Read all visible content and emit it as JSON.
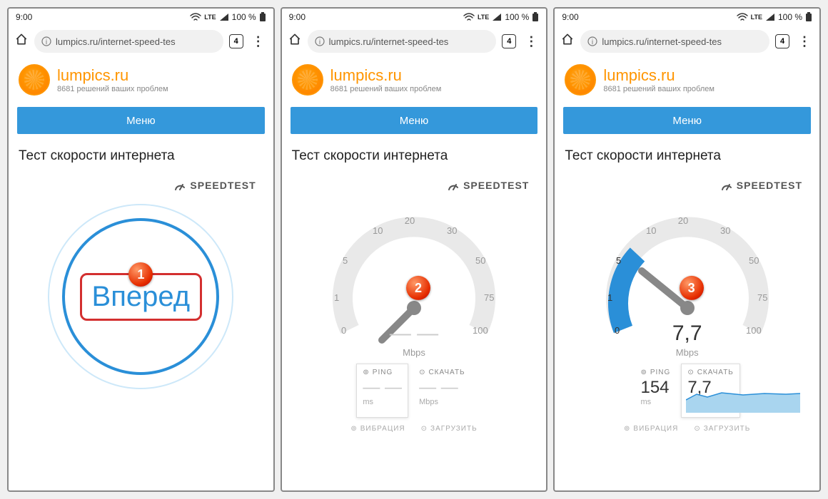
{
  "status": {
    "time": "9:00",
    "net": "LTE",
    "battery": "100 %"
  },
  "browser": {
    "url": "lumpics.ru/internet-speed-tes",
    "tabs": "4"
  },
  "site": {
    "title": "lumpics.ru",
    "subtitle": "8681 решений ваших проблем",
    "menu": "Меню"
  },
  "page": {
    "title": "Тест скорости интернета"
  },
  "speedtest": {
    "brand": "SPEEDTEST"
  },
  "go_button": "Вперед",
  "steps": {
    "s1": "1",
    "s2": "2",
    "s3": "3"
  },
  "gauge": {
    "ticks": [
      "0",
      "1",
      "5",
      "10",
      "20",
      "30",
      "50",
      "75",
      "100"
    ],
    "unit": "Mbps",
    "value_empty": "— —",
    "value3": "7,7"
  },
  "metrics": {
    "ping_label": "PING",
    "ping_unit": "ms",
    "ping_empty": "— —",
    "ping_value3": "154",
    "download_label": "СКАЧАТЬ",
    "download_unit": "Mbps",
    "download_empty": "— —",
    "download_value3": "7,7",
    "jitter_label": "ВИБРАЦИЯ",
    "upload_label": "ЗАГРУЗИТЬ"
  }
}
